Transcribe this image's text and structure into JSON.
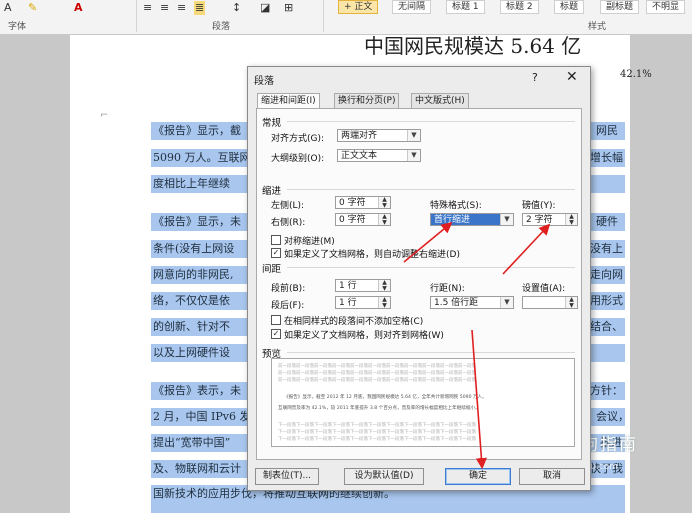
{
  "ribbon": {
    "icons": [
      "font-color-icon",
      "highlight-icon",
      "text-color-icon",
      "align-left-icon",
      "align-center-icon",
      "align-right-icon",
      "justify-icon",
      "line-spacing-icon",
      "shading-icon",
      "borders-icon"
    ],
    "group_font": "字体",
    "group_paragraph": "段落",
    "group_styles": "样式",
    "styles": [
      "+ 正文",
      "无间隔",
      "标题 1",
      "标题 2",
      "标题",
      "副标题",
      "不明显"
    ]
  },
  "document": {
    "title": "中国网民规模达 5.64 亿",
    "pct": "42.1%",
    "left_lines": [
      "《报告》显示，截",
      "5090 万人。互联网",
      "度相比上年继续",
      "《报告》显示，未",
      "条件(没有上网设",
      "网意向的非网民,",
      "络，不仅仅是依",
      "的创新、针对不",
      "以及上网硬件设",
      "《报告》表示，未",
      "2 月，中国 IPv6 发",
      "提出“宽带中国”",
      "及、物联网和云计",
      "国新技术的应用步"
    ],
    "right_lines": [
      "网民",
      "增长幅",
      "",
      "硬件",
      "没有上",
      "走向网",
      "用形式",
      "结合、",
      "",
      "方针：",
      "会议，",
      "推进",
      "快了我",
      ""
    ],
    "bottom_line": "国新技术的应用步伐，将推动互联网的继续创新。",
    "watermark": "搜狗指南",
    "watermark_sub": "zhinan.sogou.com"
  },
  "dialog": {
    "title": "段落",
    "help": "?",
    "close": "✕",
    "tabs": [
      "缩进和间距(I)",
      "换行和分页(P)",
      "中文版式(H)"
    ],
    "general": {
      "heading": "常规",
      "alignment_label": "对齐方式(G):",
      "alignment_value": "两端对齐",
      "outline_label": "大纲级别(O):",
      "outline_value": "正文文本"
    },
    "indent": {
      "heading": "缩进",
      "left_label": "左侧(L):",
      "left_value": "0 字符",
      "right_label": "右侧(R):",
      "right_value": "0 字符",
      "special_label": "特殊格式(S):",
      "special_value": "首行缩进",
      "by_label": "磅值(Y):",
      "by_value": "2 字符",
      "mirror_label": "对称缩进(M)",
      "mirror_checked": false,
      "grid_label": "如果定义了文档网格，则自动调整右缩进(D)",
      "grid_checked": true
    },
    "spacing": {
      "heading": "间距",
      "before_label": "段前(B):",
      "before_value": "1 行",
      "after_label": "段后(F):",
      "after_value": "1 行",
      "line_label": "行距(N):",
      "line_value": "1.5 倍行距",
      "at_label": "设置值(A):",
      "at_value": "",
      "nospace_label": "在相同样式的段落间不添加空格(C)",
      "nospace_checked": false,
      "snap_label": "如果定义了文档网格，则对齐到网格(W)",
      "snap_checked": true
    },
    "preview": {
      "heading": "预览",
      "prev_line": "前一段落前一段落前一段落前一段落前一段落前一段落前一段落前一段落前一段落前一段落前一段落",
      "sample_1": "《报告》显示，截至 2012 年 12 月底，我国网民规模达 5.64 亿，全年共计新增网民 5090 万人。",
      "sample_2": "互联网普及率为 42.1%，较 2011 年底提升 3.8 个百分点，普及率的增长幅度相比上年继续缩小。",
      "next_line": "下一段落下一段落下一段落下一段落下一段落下一段落下一段落下一段落下一段落下一段落下一段落"
    },
    "buttons": {
      "tabs": "制表位(T)...",
      "default": "设为默认值(D)",
      "ok": "确定",
      "cancel": "取消"
    }
  }
}
